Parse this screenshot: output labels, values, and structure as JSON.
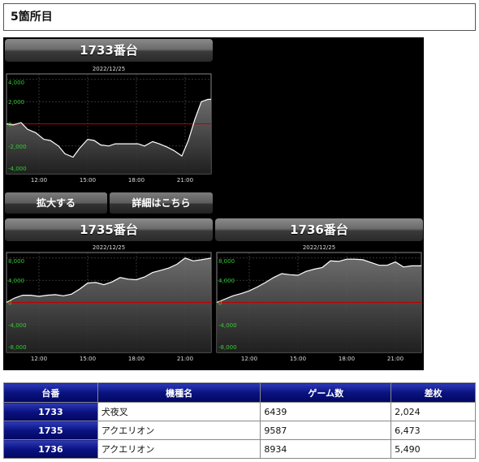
{
  "section": {
    "title": "5箇所目"
  },
  "charts": [
    {
      "machine": "1733番台",
      "date": "2022/12/25",
      "yticks": [
        "4,000",
        "2,000",
        "0",
        "-2,000",
        "-4,000"
      ],
      "xticks": [
        "12:00",
        "15:00",
        "18:00",
        "21:00"
      ],
      "buttons": {
        "zoom": "拡大する",
        "details": "詳細はこちら"
      }
    },
    {
      "machine": "1735番台",
      "date": "2022/12/25",
      "yticks": [
        "8,000",
        "4,000",
        "0",
        "-4,000",
        "-8,000"
      ],
      "xticks": [
        "12:00",
        "15:00",
        "18:00",
        "21:00"
      ]
    },
    {
      "machine": "1736番台",
      "date": "2022/12/25",
      "yticks": [
        "8,000",
        "4,000",
        "0",
        "-4,000",
        "-8,000"
      ],
      "xticks": [
        "12:00",
        "15:00",
        "18:00",
        "21:00"
      ]
    }
  ],
  "chart_data": [
    {
      "type": "area",
      "ylim": [
        -4500,
        4500
      ],
      "yticks": [
        4000,
        2000,
        0,
        -2000,
        -4000
      ],
      "xlim": [
        10,
        22.6
      ],
      "xticks": [
        12,
        15,
        18,
        21
      ],
      "x": [
        10.0,
        10.4,
        10.9,
        11.3,
        11.8,
        12.3,
        12.7,
        13.2,
        13.6,
        14.1,
        14.5,
        15.0,
        15.4,
        15.8,
        16.3,
        16.7,
        17.2,
        17.7,
        18.1,
        18.5,
        19.0,
        19.4,
        19.9,
        20.3,
        20.8,
        21.2,
        21.6,
        22.0,
        22.4,
        22.6
      ],
      "y": [
        0,
        -100,
        100,
        -500,
        -800,
        -1400,
        -1500,
        -2000,
        -2700,
        -3000,
        -2200,
        -1400,
        -1500,
        -1900,
        -2000,
        -1800,
        -1800,
        -1800,
        -1800,
        -2000,
        -1600,
        -1800,
        -2100,
        -2400,
        -2900,
        -1500,
        400,
        2000,
        2200,
        2200
      ]
    },
    {
      "type": "area",
      "ylim": [
        -9000,
        9000
      ],
      "yticks": [
        8000,
        4000,
        0,
        -4000,
        -8000
      ],
      "xlim": [
        10,
        22.6
      ],
      "xticks": [
        12,
        15,
        18,
        21
      ],
      "x": [
        10.0,
        10.5,
        11.0,
        11.5,
        12.0,
        12.5,
        13.0,
        13.5,
        14.0,
        14.5,
        15.0,
        15.5,
        16.0,
        16.5,
        17.0,
        17.5,
        18.0,
        18.5,
        19.0,
        19.5,
        20.0,
        20.5,
        21.0,
        21.5,
        22.0,
        22.6
      ],
      "y": [
        0,
        800,
        1300,
        1300,
        1100,
        1300,
        1400,
        1200,
        1500,
        2400,
        3500,
        3600,
        3200,
        3700,
        4500,
        4200,
        4100,
        4600,
        5400,
        5800,
        6200,
        6900,
        8000,
        7500,
        7700,
        8000
      ]
    },
    {
      "type": "area",
      "ylim": [
        -9000,
        9000
      ],
      "yticks": [
        8000,
        4000,
        0,
        -4000,
        -8000
      ],
      "xlim": [
        10,
        22.6
      ],
      "xticks": [
        12,
        15,
        18,
        21
      ],
      "x": [
        10.0,
        10.5,
        11.0,
        11.5,
        12.0,
        12.5,
        13.0,
        13.5,
        14.0,
        14.5,
        15.0,
        15.5,
        16.0,
        16.5,
        17.0,
        17.5,
        18.0,
        18.5,
        19.0,
        19.5,
        20.0,
        20.5,
        21.0,
        21.5,
        22.0,
        22.6
      ],
      "y": [
        0,
        600,
        1200,
        1600,
        2100,
        2800,
        3600,
        4500,
        5200,
        5000,
        4900,
        5600,
        6000,
        6300,
        7500,
        7400,
        7800,
        7800,
        7700,
        7200,
        6700,
        6700,
        7300,
        6400,
        6600,
        6600
      ]
    }
  ],
  "table": {
    "headers": [
      "台番",
      "機種名",
      "ゲーム数",
      "差枚"
    ],
    "rows": [
      [
        "1733",
        "犬夜叉",
        "6439",
        "2,024"
      ],
      [
        "1735",
        "アクエリオン",
        "9587",
        "6,473"
      ],
      [
        "1736",
        "アクエリオン",
        "8934",
        "5,490"
      ]
    ]
  },
  "colors": {
    "zero_line": "#c00000",
    "tick_label": "#33cc33",
    "plot_bg": "#000000",
    "series_line": "#ffffff",
    "header_blue": "#0a1280"
  }
}
